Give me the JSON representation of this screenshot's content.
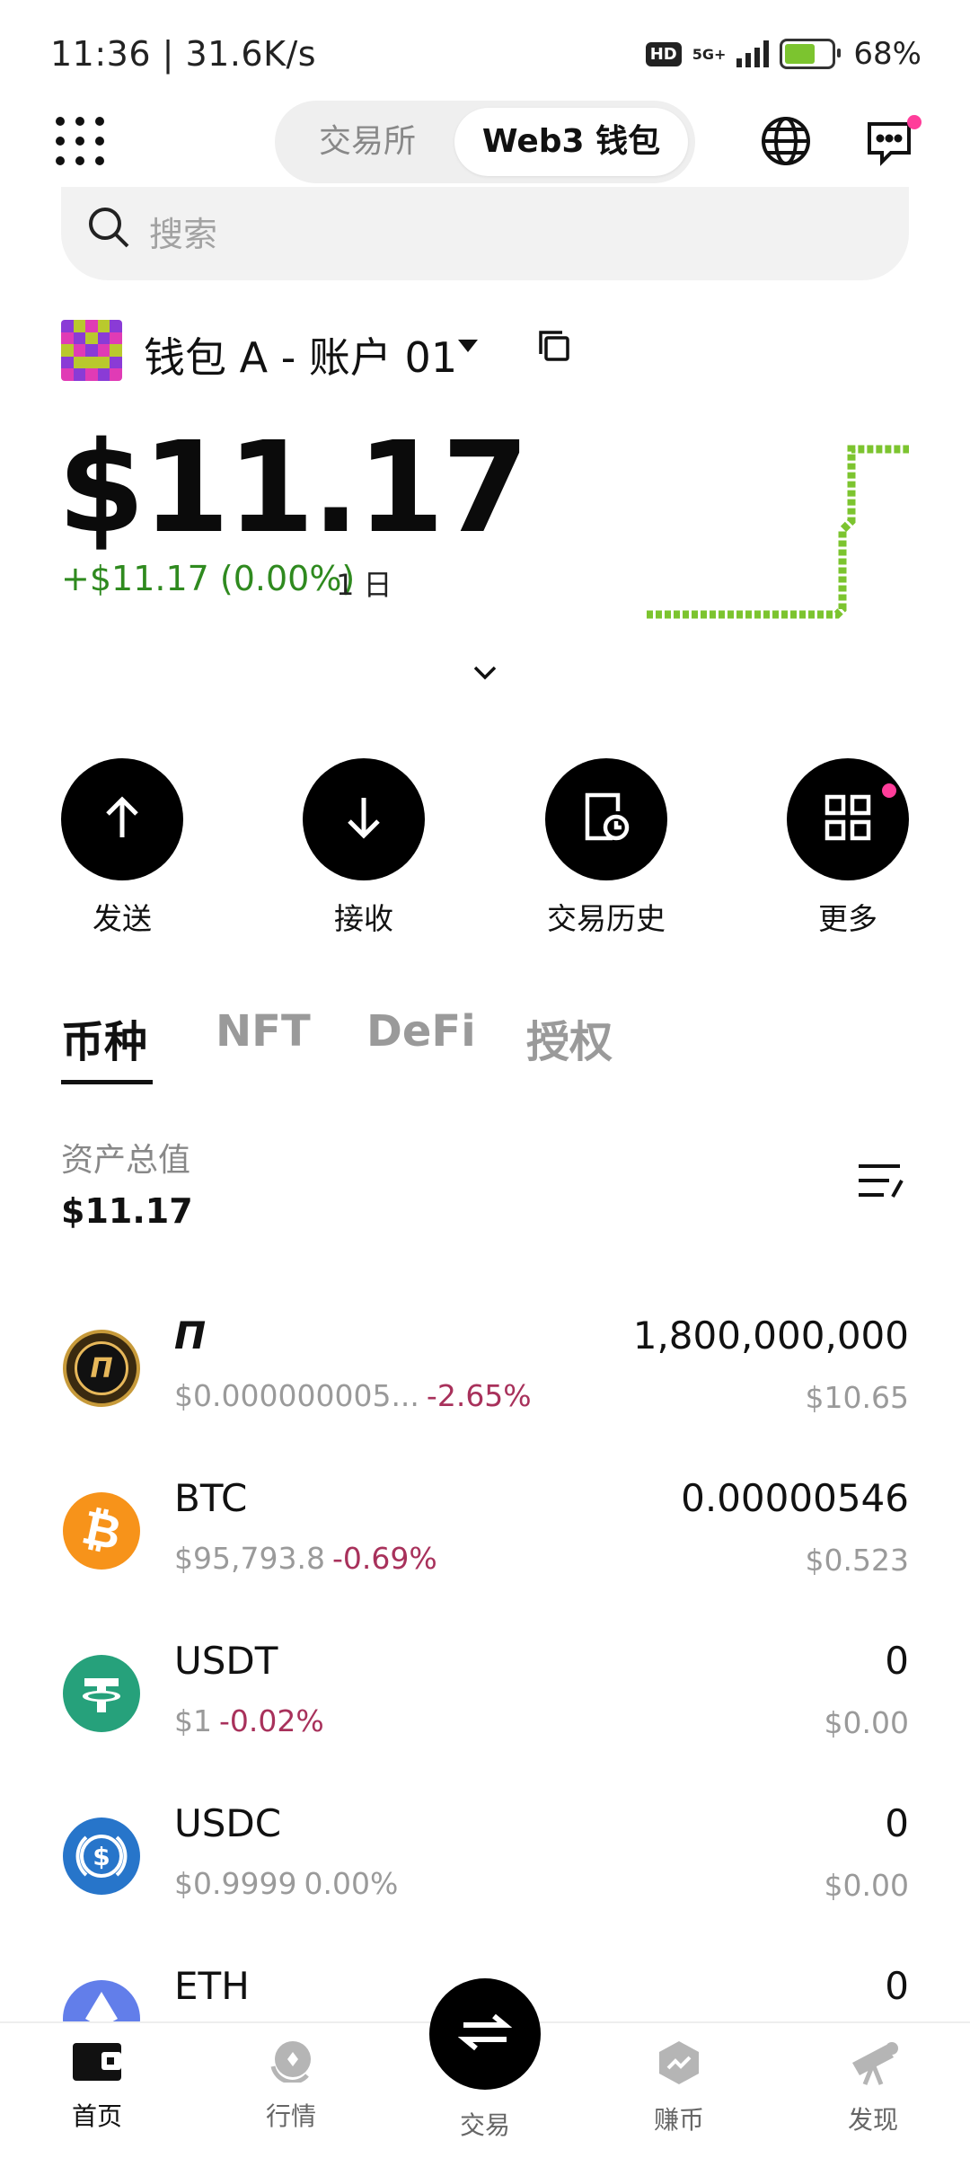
{
  "status_bar": {
    "time": "11:36 | 31.6K/s",
    "network": "5G+",
    "hd": "HD",
    "battery": "68%"
  },
  "top_nav": {
    "tab_exchange": "交易所",
    "tab_web3": "Web3 钱包"
  },
  "search": {
    "placeholder": "搜索"
  },
  "account": {
    "name": "钱包 A - 账户 01"
  },
  "balance": {
    "amount": "$11.17",
    "change": "+$11.17 (0.00%)",
    "period": "1 日"
  },
  "actions": [
    {
      "label": "发送"
    },
    {
      "label": "接收"
    },
    {
      "label": "交易历史"
    },
    {
      "label": "更多"
    }
  ],
  "asset_tabs": [
    "币种",
    "NFT",
    "DeFi",
    "授权"
  ],
  "total": {
    "label": "资产总值",
    "value": "$11.17"
  },
  "assets": [
    {
      "name": "Π",
      "price": "$0.000000005...",
      "change": "-2.65%",
      "amount": "1,800,000,000",
      "usd": "$10.65",
      "icon": "pi-coin-icon"
    },
    {
      "name": "BTC",
      "price": "$95,793.8",
      "change": "-0.69%",
      "amount": "0.00000546",
      "usd": "$0.523",
      "icon": "bitcoin-icon"
    },
    {
      "name": "USDT",
      "price": "$1",
      "change": "-0.02%",
      "amount": "0",
      "usd": "$0.00",
      "icon": "tether-icon"
    },
    {
      "name": "USDC",
      "price": "$0.9999",
      "change": "0.00%",
      "amount": "0",
      "usd": "$0.00",
      "icon": "usdc-icon"
    },
    {
      "name": "ETH",
      "price": "",
      "change": "",
      "amount": "0",
      "usd": "",
      "icon": "ethereum-icon"
    }
  ],
  "bottom_nav": [
    {
      "label": "首页"
    },
    {
      "label": "行情"
    },
    {
      "label": "交易"
    },
    {
      "label": "赚币"
    },
    {
      "label": "发现"
    }
  ],
  "colors": {
    "positive": "#2f8a1f",
    "negative": "#a8315b",
    "sparkline": "#7cc42f",
    "notification": "#ff3d9a"
  }
}
